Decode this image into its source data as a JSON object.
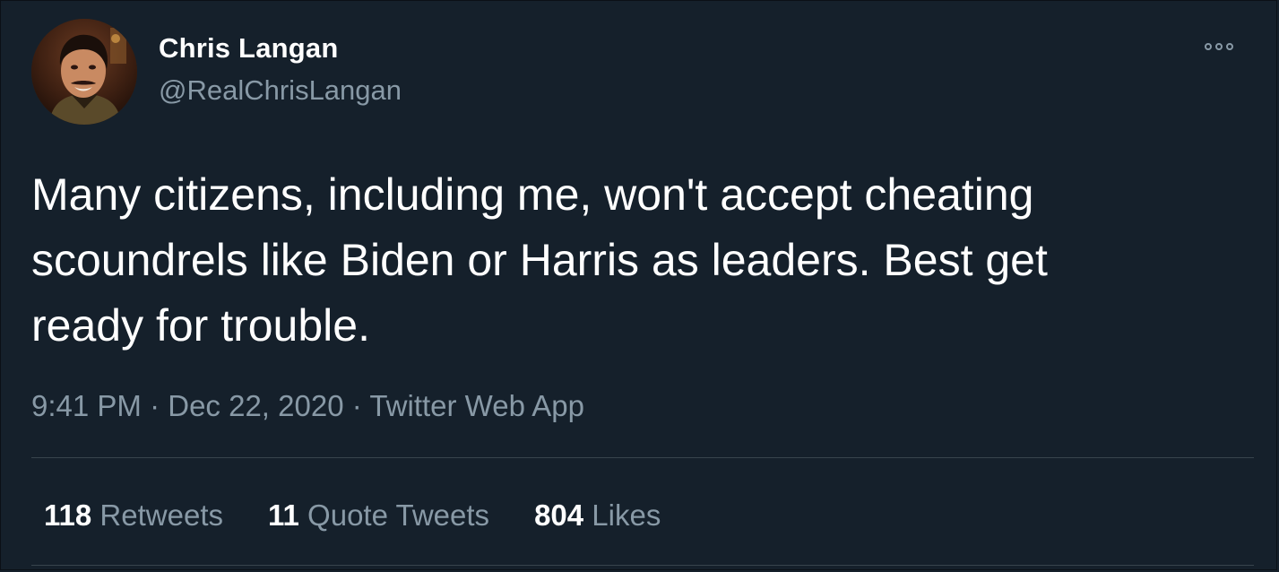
{
  "author": {
    "display_name": "Chris Langan",
    "handle": "@RealChrisLangan"
  },
  "tweet": {
    "text": "Many citizens, including me, won't accept cheating\nscoundrels like Biden or Harris as leaders. Best get\nready for trouble.",
    "time": "9:41 PM",
    "date": "Dec 22, 2020",
    "source": "Twitter Web App",
    "separator": "·"
  },
  "stats": [
    {
      "count": "118",
      "label": "Retweets"
    },
    {
      "count": "11",
      "label": "Quote Tweets"
    },
    {
      "count": "804",
      "label": "Likes"
    }
  ],
  "icons": {
    "more": "more-options-icon"
  },
  "colors": {
    "background": "#15202b",
    "secondary_text": "#8899a6",
    "divider": "#38444d"
  }
}
